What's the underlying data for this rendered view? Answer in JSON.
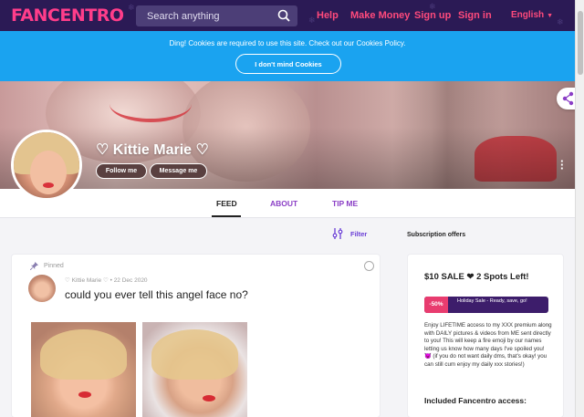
{
  "nav": {
    "logo_text": "FANCENTRO",
    "search_placeholder": "Search anything",
    "links": [
      "Help",
      "Make Money",
      "Sign up",
      "Sign in"
    ],
    "language": "English"
  },
  "cookie": {
    "message": "Ding! Cookies are required to use this site. Check out our Cookies Policy.",
    "button_label": "I don't mind Cookies"
  },
  "profile": {
    "name": "♡ Kittie Marie ♡",
    "follow_label": "Follow me",
    "message_label": "Message me"
  },
  "tabs": [
    "FEED",
    "ABOUT",
    "TIP ME"
  ],
  "active_tab": "FEED",
  "filter_label": "Filter",
  "post": {
    "pinned_label": "Pinned",
    "author": "♡ Kittie Marie ♡",
    "separator": "•",
    "date": "22 Dec 2020",
    "caption": "could you ever tell this angel face no?"
  },
  "sidebar": {
    "heading": "Subscription offers",
    "offer_title": "$10 SALE ❤ 2 Spots Left!",
    "badge": "-50%",
    "promo_text": "Holiday Sale - Ready, save, go!",
    "description": "Enjoy LIFETIME access to my XXX premium along with DAILY pictures & videos from ME sent directly to you! This will keep a fire emoji by our names letting us know how many days I've spoiled you! 😈 (if you do not want daily dms, that's okay! you can still cum enjoy my daily xxx stories!)",
    "included_heading": "Included Fancentro access:"
  },
  "colors": {
    "nav_bg": "#2b1a55",
    "accent_pink": "#ff4a7c",
    "cookie_blue": "#1aa3f0",
    "tab_purple": "#8b3fc6",
    "promo_bg": "#3d1d6b",
    "badge_pink": "#e83c6f"
  }
}
